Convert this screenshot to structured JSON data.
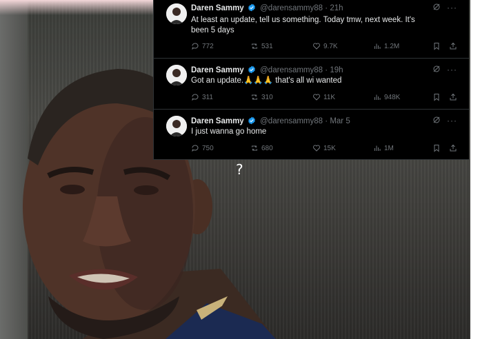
{
  "question_mark": "?",
  "tweets": [
    {
      "name": "Daren Sammy",
      "handle": "@darensammy88",
      "separator": "·",
      "time": "21h",
      "text": "At least an update, tell us something. Today tmw, next week. It's been 5 days",
      "replies": "772",
      "reposts": "531",
      "likes": "9.7K",
      "views": "1.2M"
    },
    {
      "name": "Daren Sammy",
      "handle": "@darensammy88",
      "separator": "·",
      "time": "19h",
      "text": "Got an update.🙏🙏🙏 that's all wi wanted",
      "replies": "311",
      "reposts": "310",
      "likes": "11K",
      "views": "948K"
    },
    {
      "name": "Daren Sammy",
      "handle": "@darensammy88",
      "separator": "·",
      "time": "Mar 5",
      "text": "I just wanna go home",
      "replies": "750",
      "reposts": "680",
      "likes": "15K",
      "views": "1M"
    }
  ],
  "colors": {
    "panel_bg": "#000000",
    "text_primary": "#e7e9ea",
    "text_secondary": "#71767b",
    "verified_blue": "#1d9bf0"
  },
  "icons": [
    "grok-icon",
    "more-icon",
    "reply-icon",
    "repost-icon",
    "like-icon",
    "views-icon",
    "bookmark-icon",
    "share-icon",
    "verified-badge-icon"
  ]
}
